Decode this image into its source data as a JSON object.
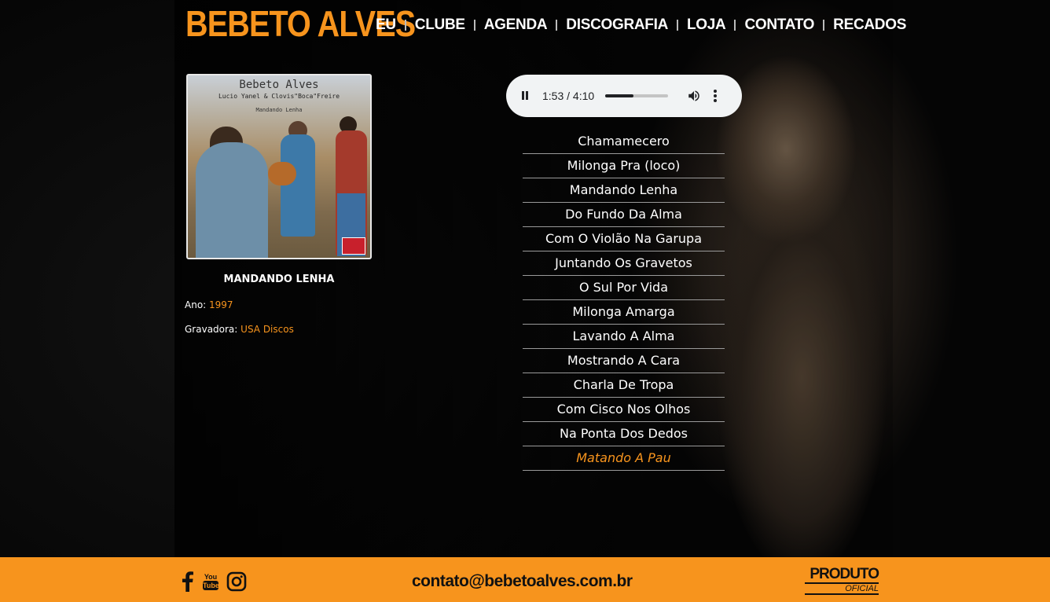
{
  "site": {
    "logo_text": "BEBETO ALVES",
    "accent_color": "#f7941d"
  },
  "nav": {
    "items": [
      {
        "label": "EU"
      },
      {
        "label": "CLUBE"
      },
      {
        "label": "AGENDA"
      },
      {
        "label": "DISCOGRAFIA"
      },
      {
        "label": "LOJA"
      },
      {
        "label": "CONTATO"
      },
      {
        "label": "RECADOS"
      }
    ]
  },
  "album": {
    "cover": {
      "artist": "Bebeto Alves",
      "subtitle": "Lucio Yanel & Clovis\"Boca\"Freire",
      "title": "Mandando Lenha",
      "badge_icon": "usa-discos-logo"
    },
    "title": "MANDANDO LENHA",
    "year_label": "Ano:",
    "year_value": "1997",
    "label_label": "Gravadora:",
    "label_value": "USA Discos"
  },
  "player": {
    "state": "playing",
    "time_display": "1:53 / 4:10",
    "progress_fraction": 0.452,
    "icons": [
      "pause-icon",
      "volume-icon",
      "more-options-icon"
    ]
  },
  "tracks": [
    {
      "title": "Chamamecero",
      "active": false
    },
    {
      "title": "Milonga Pra (loco)",
      "active": false
    },
    {
      "title": "Mandando Lenha",
      "active": false
    },
    {
      "title": "Do Fundo Da Alma",
      "active": false
    },
    {
      "title": "Com O Violão Na Garupa",
      "active": false
    },
    {
      "title": "Juntando Os Gravetos",
      "active": false
    },
    {
      "title": "O Sul Por Vida",
      "active": false
    },
    {
      "title": "Milonga Amarga",
      "active": false
    },
    {
      "title": "Lavando A Alma",
      "active": false
    },
    {
      "title": "Mostrando A Cara",
      "active": false
    },
    {
      "title": "Charla De Tropa",
      "active": false
    },
    {
      "title": "Com Cisco Nos Olhos",
      "active": false
    },
    {
      "title": "Na Ponta Dos Dedos",
      "active": false
    },
    {
      "title": "Matando A Pau",
      "active": true
    }
  ],
  "footer": {
    "social_icons": [
      "facebook-icon",
      "youtube-icon",
      "instagram-icon"
    ],
    "youtube_text_top": "You",
    "youtube_text_bottom": "Tube",
    "email": "contato@bebetoalves.com.br",
    "badge_line1": "PRODUTO",
    "badge_line2": "OFICIAL"
  }
}
